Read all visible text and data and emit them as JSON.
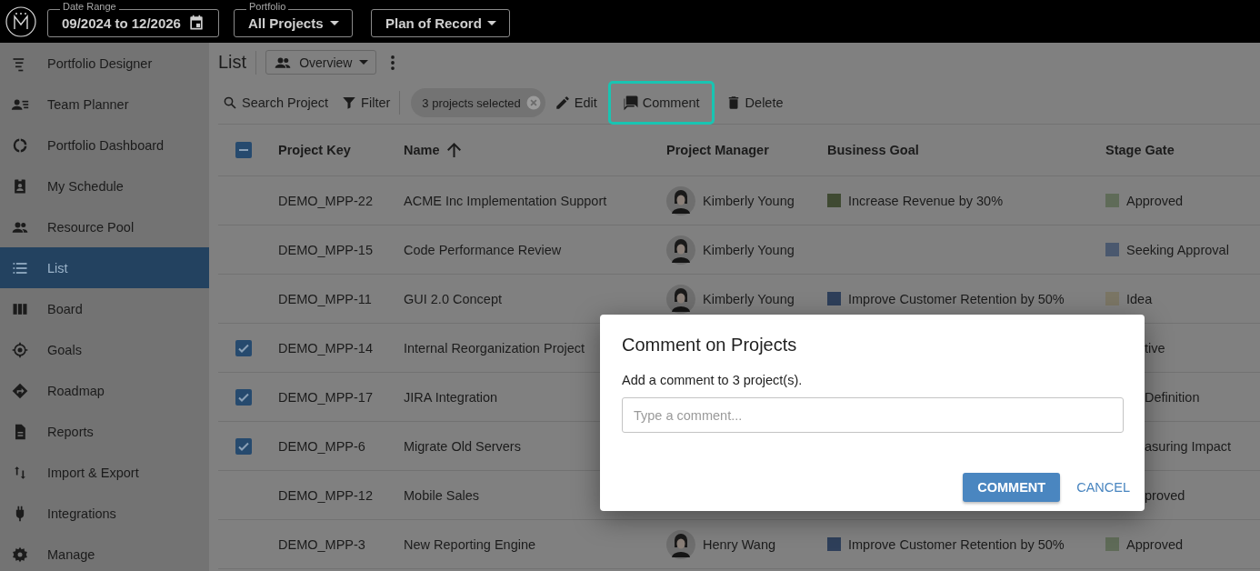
{
  "top_bar": {
    "date_range": {
      "label": "Date Range",
      "value": "09/2024 to 12/2026"
    },
    "portfolio": {
      "label": "Portfolio",
      "value": "All Projects"
    },
    "plan": {
      "value": "Plan of Record"
    }
  },
  "sidebar": {
    "items": [
      {
        "label": "Portfolio Designer",
        "selected": false
      },
      {
        "label": "Team Planner",
        "selected": false
      },
      {
        "label": "Portfolio Dashboard",
        "selected": false
      },
      {
        "label": "My Schedule",
        "selected": false
      },
      {
        "label": "Resource Pool",
        "selected": false
      },
      {
        "label": "List",
        "selected": true
      },
      {
        "label": "Board",
        "selected": false
      },
      {
        "label": "Goals",
        "selected": false
      },
      {
        "label": "Roadmap",
        "selected": false
      },
      {
        "label": "Reports",
        "selected": false
      },
      {
        "label": "Import & Export",
        "selected": false
      },
      {
        "label": "Integrations",
        "selected": false
      },
      {
        "label": "Manage",
        "selected": false
      }
    ]
  },
  "page": {
    "title": "List",
    "view": "Overview"
  },
  "toolbar": {
    "search": "Search Project",
    "filter": "Filter",
    "selection_chip": "3 projects selected",
    "actions": [
      {
        "label": "Edit",
        "highlighted": false
      },
      {
        "label": "Comment",
        "highlighted": true
      },
      {
        "label": "Delete",
        "highlighted": false
      }
    ]
  },
  "table": {
    "header_checkbox": {
      "checked": true,
      "indeterminate": true
    },
    "columns": [
      {
        "label": "Project Key"
      },
      {
        "label": "Name",
        "sorted_ascending": true
      },
      {
        "label": "Project Manager"
      },
      {
        "label": "Business Goal"
      },
      {
        "label": "Stage Gate"
      }
    ],
    "rows": [
      {
        "key": "DEMO_MPP-22",
        "name": "ACME Inc Implementation Support",
        "selected": false,
        "manager": {
          "name": "Kimberly Young"
        },
        "goal": {
          "text": "Increase Revenue by 30%",
          "color": "#3f4a32"
        },
        "stage": {
          "text": "Approved",
          "color": "#5f6b58"
        }
      },
      {
        "key": "DEMO_MPP-15",
        "name": "Code Performance Review",
        "selected": false,
        "manager": {
          "name": "Kimberly Young"
        },
        "stage": {
          "text": "Seeking Approval",
          "color": "#4a586e"
        }
      },
      {
        "key": "DEMO_MPP-11",
        "name": "GUI 2.0 Concept",
        "selected": false,
        "manager": {
          "name": "Kimberly Young"
        },
        "goal": {
          "text": "Improve Customer Retention by 50%",
          "color": "#2e3f5a"
        },
        "stage": {
          "text": "Idea",
          "color": "#7b7665"
        }
      },
      {
        "key": "DEMO_MPP-14",
        "name": "Internal Reorganization Project",
        "selected": true,
        "stage": {
          "text": "tive",
          "partial": true
        }
      },
      {
        "key": "DEMO_MPP-17",
        "name": "JIRA Integration",
        "selected": true,
        "stage": {
          "text": "Definition",
          "partial": true
        }
      },
      {
        "key": "DEMO_MPP-6",
        "name": "Migrate Old Servers",
        "selected": true,
        "stage": {
          "text": "asuring Impact",
          "partial": true
        }
      },
      {
        "key": "DEMO_MPP-12",
        "name": "Mobile Sales",
        "selected": false,
        "stage": {
          "text": "proved",
          "partial": true
        }
      },
      {
        "key": "DEMO_MPP-3",
        "name": "New Reporting Engine",
        "selected": false,
        "manager": {
          "name": "Henry Wang"
        },
        "goal": {
          "text": "Improve Customer Retention by 50%",
          "color": "#2e3f5a"
        },
        "stage": {
          "text": "Approved",
          "color": "#5f6b58"
        }
      }
    ]
  },
  "dialog": {
    "title": "Comment on Projects",
    "message": "Add a comment to 3 project(s).",
    "placeholder": "Type a comment...",
    "buttons": [
      {
        "label": "COMMENT",
        "kind": "primary"
      },
      {
        "label": "CANCEL",
        "kind": "text"
      }
    ]
  }
}
